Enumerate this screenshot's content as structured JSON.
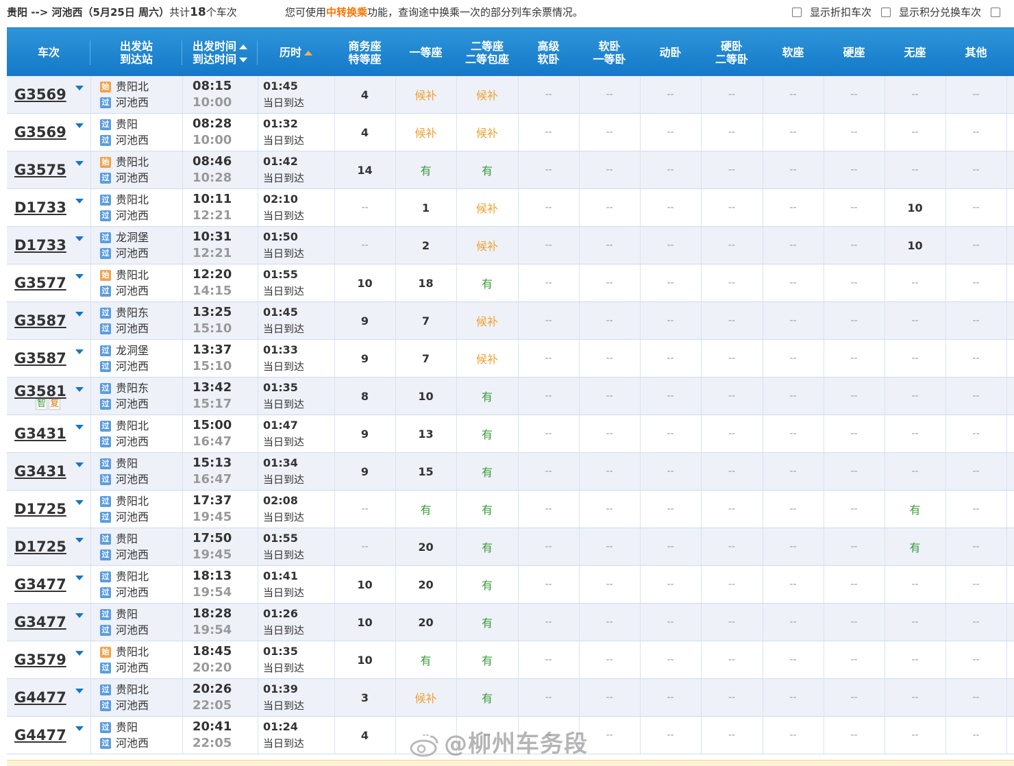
{
  "header": {
    "from": "贵阳",
    "arrow": "-->",
    "to": "河池西",
    "date": "（5月25日  周六）",
    "count_prefix": "共计",
    "count": "18",
    "count_suffix": "个车次",
    "tip_prefix": "您可使用",
    "tip_highlight": "中转换乘",
    "tip_suffix": "功能，查询途中换乘一次的部分列车余票情况。",
    "checkbox_discount": "显示折扣车次",
    "checkbox_points": "显示积分兑换车次"
  },
  "columns": {
    "train": "车次",
    "from_station": "出发站",
    "to_station": "到达站",
    "dep_time": "出发时间",
    "arr_time": "到达时间",
    "duration": "历时",
    "business_1": "商务座",
    "business_2": "特等座",
    "first": "一等座",
    "second_1": "二等座",
    "second_2": "二等包座",
    "advsoft_1": "高级",
    "advsoft_2": "软卧",
    "soft_1": "软卧",
    "soft_2": "一等卧",
    "dongwo": "动卧",
    "hard_1": "硬卧",
    "hard_2": "二等卧",
    "softseat": "软座",
    "hardseat": "硬座",
    "noseat": "无座",
    "other": "其他"
  },
  "badges": {
    "start": "始",
    "pass": "过"
  },
  "marks": {
    "zhi": "智",
    "fu": "复"
  },
  "watermark": "@柳州车务段",
  "rows": [
    {
      "no": "G3569",
      "from_type": "start",
      "from": "贵阳北",
      "to_type": "pass",
      "to": "河池西",
      "dep": "08:15",
      "arr": "10:00",
      "dur": "01:45",
      "arrive_note": "当日到达",
      "seats": [
        "4",
        "候补",
        "候补",
        "--",
        "--",
        "--",
        "--",
        "--",
        "--",
        "--",
        "--"
      ]
    },
    {
      "no": "G3569",
      "from_type": "pass",
      "from": "贵阳",
      "to_type": "pass",
      "to": "河池西",
      "dep": "08:28",
      "arr": "10:00",
      "dur": "01:32",
      "arrive_note": "当日到达",
      "seats": [
        "4",
        "候补",
        "候补",
        "--",
        "--",
        "--",
        "--",
        "--",
        "--",
        "--",
        "--"
      ]
    },
    {
      "no": "G3575",
      "from_type": "start",
      "from": "贵阳北",
      "to_type": "pass",
      "to": "河池西",
      "dep": "08:46",
      "arr": "10:28",
      "dur": "01:42",
      "arrive_note": "当日到达",
      "seats": [
        "14",
        "有",
        "有",
        "--",
        "--",
        "--",
        "--",
        "--",
        "--",
        "--",
        "--"
      ]
    },
    {
      "no": "D1733",
      "from_type": "pass",
      "from": "贵阳北",
      "to_type": "pass",
      "to": "河池西",
      "dep": "10:11",
      "arr": "12:21",
      "dur": "02:10",
      "arrive_note": "当日到达",
      "seats": [
        "--",
        "1",
        "候补",
        "--",
        "--",
        "--",
        "--",
        "--",
        "--",
        "10",
        "--"
      ]
    },
    {
      "no": "D1733",
      "from_type": "pass",
      "from": "龙洞堡",
      "to_type": "pass",
      "to": "河池西",
      "dep": "10:31",
      "arr": "12:21",
      "dur": "01:50",
      "arrive_note": "当日到达",
      "seats": [
        "--",
        "2",
        "候补",
        "--",
        "--",
        "--",
        "--",
        "--",
        "--",
        "10",
        "--"
      ]
    },
    {
      "no": "G3577",
      "from_type": "start",
      "from": "贵阳北",
      "to_type": "pass",
      "to": "河池西",
      "dep": "12:20",
      "arr": "14:15",
      "dur": "01:55",
      "arrive_note": "当日到达",
      "seats": [
        "10",
        "18",
        "有",
        "--",
        "--",
        "--",
        "--",
        "--",
        "--",
        "--",
        "--"
      ]
    },
    {
      "no": "G3587",
      "from_type": "pass",
      "from": "贵阳东",
      "to_type": "pass",
      "to": "河池西",
      "dep": "13:25",
      "arr": "15:10",
      "dur": "01:45",
      "arrive_note": "当日到达",
      "seats": [
        "9",
        "7",
        "候补",
        "--",
        "--",
        "--",
        "--",
        "--",
        "--",
        "--",
        "--"
      ]
    },
    {
      "no": "G3587",
      "from_type": "pass",
      "from": "龙洞堡",
      "to_type": "pass",
      "to": "河池西",
      "dep": "13:37",
      "arr": "15:10",
      "dur": "01:33",
      "arrive_note": "当日到达",
      "seats": [
        "9",
        "7",
        "候补",
        "--",
        "--",
        "--",
        "--",
        "--",
        "--",
        "--",
        "--"
      ]
    },
    {
      "no": "G3581",
      "from_type": "pass",
      "from": "贵阳东",
      "to_type": "pass",
      "to": "河池西",
      "dep": "13:42",
      "arr": "15:17",
      "dur": "01:35",
      "arrive_note": "当日到达",
      "seats": [
        "8",
        "10",
        "有",
        "--",
        "--",
        "--",
        "--",
        "--",
        "--",
        "--",
        "--"
      ],
      "marks": true
    },
    {
      "no": "G3431",
      "from_type": "pass",
      "from": "贵阳北",
      "to_type": "pass",
      "to": "河池西",
      "dep": "15:00",
      "arr": "16:47",
      "dur": "01:47",
      "arrive_note": "当日到达",
      "seats": [
        "9",
        "13",
        "有",
        "--",
        "--",
        "--",
        "--",
        "--",
        "--",
        "--",
        "--"
      ]
    },
    {
      "no": "G3431",
      "from_type": "pass",
      "from": "贵阳",
      "to_type": "pass",
      "to": "河池西",
      "dep": "15:13",
      "arr": "16:47",
      "dur": "01:34",
      "arrive_note": "当日到达",
      "seats": [
        "9",
        "15",
        "有",
        "--",
        "--",
        "--",
        "--",
        "--",
        "--",
        "--",
        "--"
      ]
    },
    {
      "no": "D1725",
      "from_type": "pass",
      "from": "贵阳北",
      "to_type": "pass",
      "to": "河池西",
      "dep": "17:37",
      "arr": "19:45",
      "dur": "02:08",
      "arrive_note": "当日到达",
      "seats": [
        "--",
        "有",
        "有",
        "--",
        "--",
        "--",
        "--",
        "--",
        "--",
        "有",
        "--"
      ]
    },
    {
      "no": "D1725",
      "from_type": "pass",
      "from": "贵阳",
      "to_type": "pass",
      "to": "河池西",
      "dep": "17:50",
      "arr": "19:45",
      "dur": "01:55",
      "arrive_note": "当日到达",
      "seats": [
        "--",
        "20",
        "有",
        "--",
        "--",
        "--",
        "--",
        "--",
        "--",
        "有",
        "--"
      ]
    },
    {
      "no": "G3477",
      "from_type": "pass",
      "from": "贵阳北",
      "to_type": "pass",
      "to": "河池西",
      "dep": "18:13",
      "arr": "19:54",
      "dur": "01:41",
      "arrive_note": "当日到达",
      "seats": [
        "10",
        "20",
        "有",
        "--",
        "--",
        "--",
        "--",
        "--",
        "--",
        "--",
        "--"
      ]
    },
    {
      "no": "G3477",
      "from_type": "pass",
      "from": "贵阳",
      "to_type": "pass",
      "to": "河池西",
      "dep": "18:28",
      "arr": "19:54",
      "dur": "01:26",
      "arrive_note": "当日到达",
      "seats": [
        "10",
        "20",
        "有",
        "--",
        "--",
        "--",
        "--",
        "--",
        "--",
        "--",
        "--"
      ]
    },
    {
      "no": "G3579",
      "from_type": "start",
      "from": "贵阳北",
      "to_type": "pass",
      "to": "河池西",
      "dep": "18:45",
      "arr": "20:20",
      "dur": "01:35",
      "arrive_note": "当日到达",
      "seats": [
        "10",
        "有",
        "有",
        "--",
        "--",
        "--",
        "--",
        "--",
        "--",
        "--",
        "--"
      ]
    },
    {
      "no": "G4477",
      "from_type": "pass",
      "from": "贵阳北",
      "to_type": "pass",
      "to": "河池西",
      "dep": "20:26",
      "arr": "22:05",
      "dur": "01:39",
      "arrive_note": "当日到达",
      "seats": [
        "3",
        "候补",
        "有",
        "--",
        "--",
        "--",
        "--",
        "--",
        "--",
        "--",
        "--"
      ]
    },
    {
      "no": "G4477",
      "from_type": "pass",
      "from": "贵阳",
      "to_type": "pass",
      "to": "河池西",
      "dep": "20:41",
      "arr": "22:05",
      "dur": "01:24",
      "arrive_note": "当日到达",
      "seats": [
        "4",
        "--",
        "--",
        "--",
        "--",
        "--",
        "--",
        "--",
        "--",
        "--",
        "--"
      ]
    }
  ]
}
